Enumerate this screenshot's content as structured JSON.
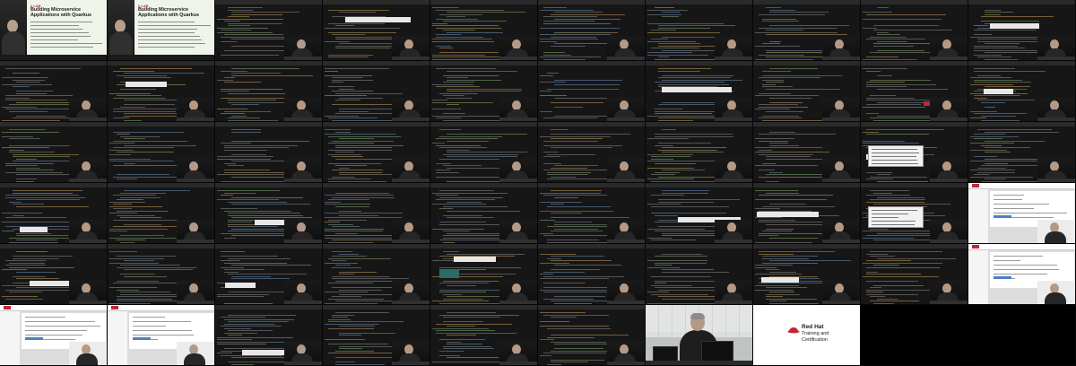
{
  "intro_slide": {
    "label": "// LAB",
    "title": "Building Microservice Applications with Quarkus"
  },
  "end_card": {
    "brand": "Red Hat",
    "subtitle_line1": "Training and",
    "subtitle_line2": "Certification"
  },
  "colors": {
    "background": "#0d0d0d",
    "code_background": "#161616",
    "brand_red": "#c0283a",
    "slide_background": "#e9f1e6"
  },
  "grid": {
    "columns": 10,
    "rows": 6,
    "frames": [
      "slide",
      "slide",
      "code",
      "code",
      "code",
      "code",
      "code",
      "code",
      "code",
      "code",
      "code",
      "code",
      "code",
      "code",
      "code",
      "code",
      "code",
      "code",
      "code",
      "code",
      "code",
      "code",
      "code",
      "code",
      "code",
      "code",
      "code",
      "code",
      "code",
      "code",
      "code",
      "code",
      "code",
      "code",
      "code",
      "code",
      "code",
      "code",
      "code",
      "browser",
      "code",
      "code",
      "code",
      "code",
      "code",
      "code",
      "code",
      "code",
      "code",
      "browser",
      "browser",
      "browser",
      "code",
      "code",
      "code",
      "code",
      "camera",
      "endcard",
      "empty",
      "empty"
    ]
  }
}
